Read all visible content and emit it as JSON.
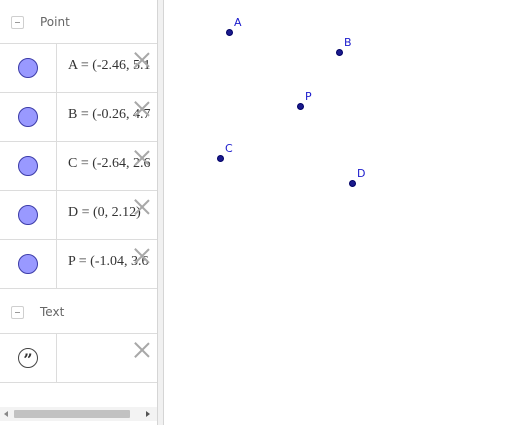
{
  "algebra": {
    "groups": [
      {
        "title": "Point"
      },
      {
        "title": "Text"
      }
    ],
    "points": [
      {
        "expr": "A = (-2.46, 5.1"
      },
      {
        "expr": "B = (-0.26, 4.7"
      },
      {
        "expr": "C = (-2.64, 2.6"
      },
      {
        "expr": "D = (0, 2.12)"
      },
      {
        "expr": "P = (-1.04, 3.6"
      }
    ],
    "texts": [
      {
        "expr": ""
      }
    ]
  },
  "graphics": {
    "points": [
      {
        "label": "A"
      },
      {
        "label": "B"
      },
      {
        "label": "P"
      },
      {
        "label": "C"
      },
      {
        "label": "D"
      }
    ]
  },
  "colors": {
    "marble_fill": "#9999ff",
    "point_fill": "#1a1a8c",
    "label_color": "#1a1acc"
  },
  "icons": {
    "group_toggle": "minus-square-icon",
    "delete": "close-x-icon",
    "text_object": "quote-icon"
  }
}
